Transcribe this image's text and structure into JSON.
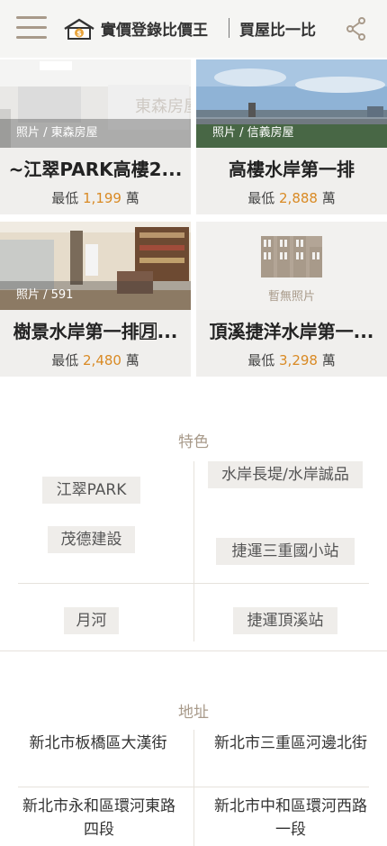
{
  "header": {
    "brand": "實價登錄比價王",
    "tagline": "買屋比一比"
  },
  "cards": [
    {
      "badge": "照片 / 東森房屋",
      "name": "~江翠PARK高樓2...",
      "price_prefix": "最低",
      "price": "1,199",
      "price_unit": "萬"
    },
    {
      "badge": "照片 / 信義房屋",
      "name": "高樓水岸第一排",
      "price_prefix": "最低",
      "price": "2,888",
      "price_unit": "萬"
    },
    {
      "badge": "照片 / 591",
      "name": "樹景水岸第一排🈷...",
      "price_prefix": "最低",
      "price": "2,480",
      "price_unit": "萬"
    },
    {
      "nophoto_label": "暫無照片",
      "name": "頂溪捷洋水岸第一...",
      "price_prefix": "最低",
      "price": "3,298",
      "price_unit": "萬"
    }
  ],
  "features": {
    "title": "特色",
    "tags": [
      "江翠PARK",
      "水岸長堤/水岸誠品",
      "茂德建設",
      "捷運三重國小站",
      "月河",
      "捷運頂溪站"
    ]
  },
  "address": {
    "title": "地址",
    "items": [
      "新北市板橋區大漢街",
      "新北市三重區河邊北街",
      "新北市永和區環河東路四段",
      "新北市中和區環河西路一段"
    ]
  },
  "colors": {
    "accent": "#d98a24",
    "muted": "#a89a8a",
    "card_bg": "#f0efed"
  }
}
